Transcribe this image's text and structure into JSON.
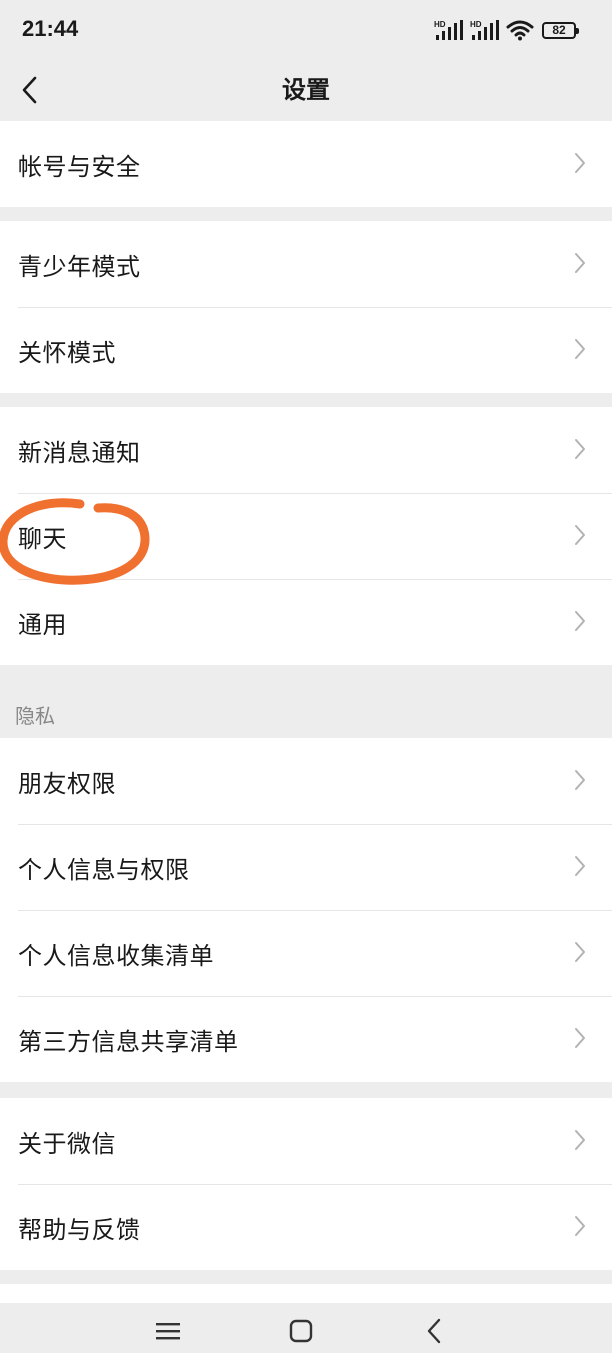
{
  "status_bar": {
    "time": "21:44",
    "signal_1_label": "HD",
    "signal_2_label": "HD",
    "battery_level": "82"
  },
  "header": {
    "title": "设置",
    "back_icon": "chevron-left-icon"
  },
  "groups": [
    {
      "items": [
        {
          "label": "帐号与安全"
        }
      ]
    },
    {
      "items": [
        {
          "label": "青少年模式"
        },
        {
          "label": "关怀模式"
        }
      ]
    },
    {
      "items": [
        {
          "label": "新消息通知"
        },
        {
          "label": "聊天"
        },
        {
          "label": "通用"
        }
      ]
    },
    {
      "items": [
        {
          "label": "朋友权限"
        },
        {
          "label": "个人信息与权限"
        },
        {
          "label": "个人信息收集清单"
        },
        {
          "label": "第三方信息共享清单"
        }
      ]
    },
    {
      "items": [
        {
          "label": "关于微信"
        },
        {
          "label": "帮助与反馈"
        }
      ]
    }
  ],
  "privacy_section_header": "隐私",
  "annotation": {
    "color": "#f07030",
    "target": "聊天"
  },
  "system_nav": {
    "menu_icon": "menu-icon",
    "home_icon": "square-home-icon",
    "back_icon": "triangle-back-icon"
  },
  "colors": {
    "background": "#ededed",
    "card": "#ffffff",
    "text": "#191919",
    "secondary_text": "#888888",
    "chevron": "#b2b2b2"
  }
}
